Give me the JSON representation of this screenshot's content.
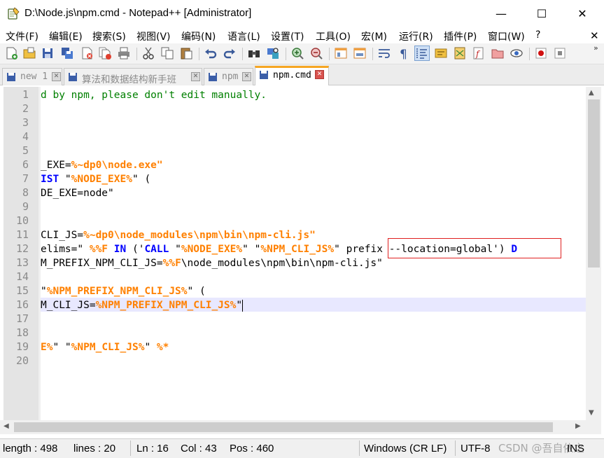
{
  "window": {
    "title": "D:\\Node.js\\npm.cmd - Notepad++ [Administrator]",
    "minimize_glyph": "—",
    "maximize_glyph": "☐",
    "close_glyph": "✕"
  },
  "menu": {
    "items": [
      "文件(F)",
      "编辑(E)",
      "搜索(S)",
      "视图(V)",
      "编码(N)",
      "语言(L)",
      "设置(T)",
      "工具(O)",
      "宏(M)",
      "运行(R)",
      "插件(P)",
      "窗口(W)",
      "?"
    ],
    "close_glyph": "✕"
  },
  "toolbar": {
    "overflow_glyph": "»",
    "icons": [
      "new-file-icon",
      "open-file-icon",
      "save-icon",
      "save-all-icon",
      "close-icon",
      "close-all-icon",
      "print-icon",
      "cut-icon",
      "copy-icon",
      "paste-icon",
      "undo-icon",
      "redo-icon",
      "find-icon",
      "replace-icon",
      "zoom-in-icon",
      "zoom-out-icon",
      "sync-vertical-icon",
      "sync-horizontal-icon",
      "word-wrap-icon",
      "show-all-chars-icon",
      "indent-guide-icon",
      "define-language-icon",
      "document-map-icon",
      "function-list-icon",
      "folder-workspace-icon",
      "monitoring-icon",
      "record-macro-icon",
      "stop-record-icon"
    ],
    "colors": {
      "accent": "#2b6cd4",
      "save": "#3b5ea8",
      "record": "#d01010"
    }
  },
  "tabs": [
    {
      "label": "new 1",
      "active": false,
      "icon": "saved-file-icon"
    },
    {
      "label": "算法和数据结构新手班",
      "active": false,
      "icon": "saved-file-icon"
    },
    {
      "label": "npm",
      "active": false,
      "icon": "saved-file-icon"
    },
    {
      "label": "npm.cmd",
      "active": true,
      "icon": "saved-file-icon"
    }
  ],
  "tab_close_glyph": "✕",
  "editor": {
    "line_numbers": [
      "1",
      "2",
      "3",
      "4",
      "5",
      "6",
      "7",
      "8",
      "9",
      "10",
      "11",
      "12",
      "13",
      "14",
      "15",
      "16",
      "17",
      "18",
      "19",
      "20"
    ],
    "current_line": 16,
    "lines": [
      [
        {
          "t": "d by npm, please don't edit manually.",
          "c": "comment"
        }
      ],
      [],
      [],
      [],
      [],
      [
        {
          "t": "_EXE=",
          "c": "plain"
        },
        {
          "t": "%~dp0",
          "c": "var"
        },
        {
          "t": "\\node.exe\"",
          "c": "var"
        }
      ],
      [
        {
          "t": "IST",
          "c": "kw"
        },
        {
          "t": " \"",
          "c": "plain"
        },
        {
          "t": "%NODE_EXE%",
          "c": "var"
        },
        {
          "t": "\" (",
          "c": "plain"
        }
      ],
      [
        {
          "t": "DE_EXE=node\"",
          "c": "plain"
        }
      ],
      [],
      [],
      [
        {
          "t": "CLI_JS=",
          "c": "plain"
        },
        {
          "t": "%~dp0",
          "c": "var"
        },
        {
          "t": "\\node_modules\\npm\\bin\\npm-cli.js\"",
          "c": "var"
        }
      ],
      [
        {
          "t": "elims=\" ",
          "c": "plain"
        },
        {
          "t": "%%F",
          "c": "var"
        },
        {
          "t": " ",
          "c": "plain"
        },
        {
          "t": "IN",
          "c": "kw"
        },
        {
          "t": " ('",
          "c": "plain"
        },
        {
          "t": "CALL",
          "c": "kw"
        },
        {
          "t": " \"",
          "c": "plain"
        },
        {
          "t": "%NODE_EXE%",
          "c": "var"
        },
        {
          "t": "\" \"",
          "c": "plain"
        },
        {
          "t": "%NPM_CLI_JS%",
          "c": "var"
        },
        {
          "t": "\" ",
          "c": "plain"
        },
        {
          "t": "prefix --location=global",
          "c": "plain"
        },
        {
          "t": "') ",
          "c": "plain"
        },
        {
          "t": "D",
          "c": "kw"
        }
      ],
      [
        {
          "t": "M_PREFIX_NPM_CLI_JS=",
          "c": "plain"
        },
        {
          "t": "%%F",
          "c": "var"
        },
        {
          "t": "\\node_modules\\npm\\bin\\npm-cli.js\"",
          "c": "plain"
        }
      ],
      [],
      [
        {
          "t": "\"",
          "c": "plain"
        },
        {
          "t": "%NPM_PREFIX_NPM_CLI_JS%",
          "c": "var"
        },
        {
          "t": "\" (",
          "c": "plain"
        }
      ],
      [
        {
          "t": "M_CLI_JS=",
          "c": "plain"
        },
        {
          "t": "%NPM_PREFIX_NPM_CLI_JS%",
          "c": "var"
        },
        {
          "t": "\"",
          "c": "plain"
        }
      ],
      [],
      [],
      [
        {
          "t": "E%",
          "c": "var"
        },
        {
          "t": "\" \"",
          "c": "plain"
        },
        {
          "t": "%NPM_CLI_JS%",
          "c": "var"
        },
        {
          "t": "\" ",
          "c": "plain"
        },
        {
          "t": "%*",
          "c": "var"
        }
      ],
      []
    ],
    "colors": {
      "comment": "#008000",
      "variable": "#ff8000",
      "keyword": "#0000ff",
      "current_line_bg": "#e8e8ff",
      "gutter_bg": "#e4e4e4"
    }
  },
  "scrollbars": {
    "up_glyph": "▲",
    "down_glyph": "▼",
    "left_glyph": "◀",
    "right_glyph": "▶"
  },
  "status": {
    "length": "length : 498",
    "lines": "lines : 20",
    "ln": "Ln : 16",
    "col": "Col : 43",
    "pos": "Pos : 460",
    "eol": "Windows (CR LF)",
    "encoding": "UTF-8",
    "mode": "INS",
    "watermark": "CSDN @吾自依之"
  }
}
